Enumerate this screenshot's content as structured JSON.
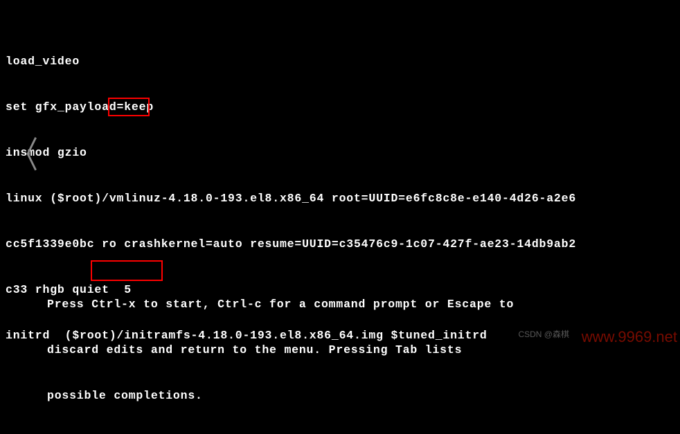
{
  "boot": {
    "line1": "load_video",
    "line2": "set gfx_payload=keep",
    "line3": "insmod gzio",
    "line4": "linux ($root)/vmlinuz-4.18.0-193.el8.x86_64 root=UUID=e6fc8c8e-e140-4d26-a2e6",
    "line5": "cc5f1339e0bc ro crashkernel=auto resume=UUID=c35476c9-1c07-427f-ae23-14db9ab2",
    "line6": "c33 rhgb quiet  5",
    "line7": "initrd  ($root)/initramfs-4.18.0-193.el8.x86_64.img $tuned_initrd"
  },
  "hint": {
    "line1": "Press Ctrl-x to start, Ctrl-c for a command prompt or Escape to",
    "line2": "discard edits and return to the menu. Pressing Tab lists",
    "line3": "possible completions."
  },
  "nav": {
    "back": "〈"
  },
  "watermark": {
    "csdn": "CSDN @森棋",
    "site": "www.9969.net"
  },
  "highlights": {
    "runlevel": "5",
    "shortcut": "Ctrl-x"
  }
}
